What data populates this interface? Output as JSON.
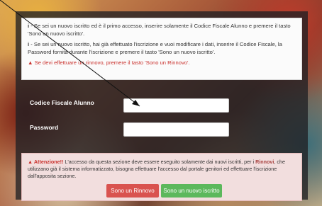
{
  "info": {
    "line1_prefix": "i",
    "line1_text": " - Se sei un nuovo iscritto ed è il primo accesso, inserire solamente il Codice Fiscale Alunno e premere il tasto 'Sono un nuovo iscritto'.",
    "line2_prefix": "i",
    "line2_text": " - Se sei un nuovo iscritto, hai già effettuato l'iscrizione e vuoi modificare i dati, inserire il Codice Fiscale, la Password fornita durante l'iscrizione e premere il tasto 'Sono un nuovo iscritto'.",
    "line3_icon": "▲",
    "line3_text": " Se devi effettuare un rinnovo, premere il tasto 'Sono un Rinnovo'."
  },
  "form": {
    "codice_label": "Codice Fiscale Alunno",
    "codice_value": "",
    "password_label": "Password",
    "password_value": ""
  },
  "warning": {
    "icon": "▲",
    "title": "Attenzione!!",
    "text_a": " L'accesso da questa sezione deve essere eseguito solamente dai nuovi iscritti, per i ",
    "rinnovi": "Rinnovi",
    "text_b": ", che utilizzano già il sistema informatizzato, bisogna effettuare l'accesso dal portale genitori ed effettuare l'iscrizione dall'apposita sezione."
  },
  "buttons": {
    "rinnovo": "Sono un Rinnovo",
    "nuovo": "Sono un nuovo iscritto"
  },
  "colors": {
    "red_button": "#d9534f",
    "green_button": "#5cb85c",
    "alert_red": "#c9302c"
  }
}
